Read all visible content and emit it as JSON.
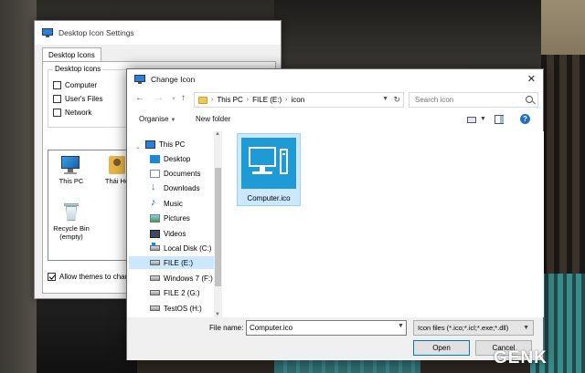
{
  "background_watermark": "GENK",
  "settings_window": {
    "title": "Desktop Icon Settings",
    "tab": "Desktop Icons",
    "group_label": "Desktop icons",
    "checkboxes": [
      {
        "label": "Computer",
        "checked": false
      },
      {
        "label": "User's Files",
        "checked": false
      },
      {
        "label": "Network",
        "checked": false
      }
    ],
    "icons": [
      {
        "label": "This PC",
        "icon": "computer-icon"
      },
      {
        "label": "Thái Họ",
        "icon": "user-folder-icon"
      },
      {
        "label": "Recycle Bin (empty)",
        "icon": "recycle-bin-icon"
      }
    ],
    "allow_themes_label": "Allow themes to change",
    "allow_themes_checked": true
  },
  "change_icon_dialog": {
    "title": "Change Icon",
    "close_glyph": "✕",
    "nav": {
      "back": "←",
      "forward": "→",
      "up": "↑"
    },
    "breadcrumb": [
      "This PC",
      "FILE (E:)",
      "icon"
    ],
    "search_placeholder": "Search icon",
    "toolbar": {
      "organise": "Organise",
      "new_folder": "New folder",
      "help": "?"
    },
    "nav_items": [
      {
        "label": "This PC",
        "icon": "pc"
      },
      {
        "label": "Desktop",
        "icon": "desk"
      },
      {
        "label": "Documents",
        "icon": "docs"
      },
      {
        "label": "Downloads",
        "icon": "down"
      },
      {
        "label": "Music",
        "icon": "music"
      },
      {
        "label": "Pictures",
        "icon": "pics"
      },
      {
        "label": "Videos",
        "icon": "vids"
      },
      {
        "label": "Local Disk (C:)",
        "icon": "drive-win"
      },
      {
        "label": "FILE (E:)",
        "icon": "drive",
        "selected": true
      },
      {
        "label": "Windows 7 (F:)",
        "icon": "drive"
      },
      {
        "label": "FILE 2 (G:)",
        "icon": "drive"
      },
      {
        "label": "TestOS (H:)",
        "icon": "drive"
      }
    ],
    "files": [
      {
        "name": "Computer.ico",
        "selected": true
      }
    ],
    "file_name_label": "File name:",
    "file_name_value": "Computer.ico",
    "file_type": "Icon files (*.ico;*.icl;*.exe;*.dll)",
    "open_label": "Open",
    "cancel_label": "Cancel"
  },
  "colors": {
    "selection": "#cce8ff",
    "thumb_blue": "#1e9bd7",
    "accent": "#0078d7"
  }
}
